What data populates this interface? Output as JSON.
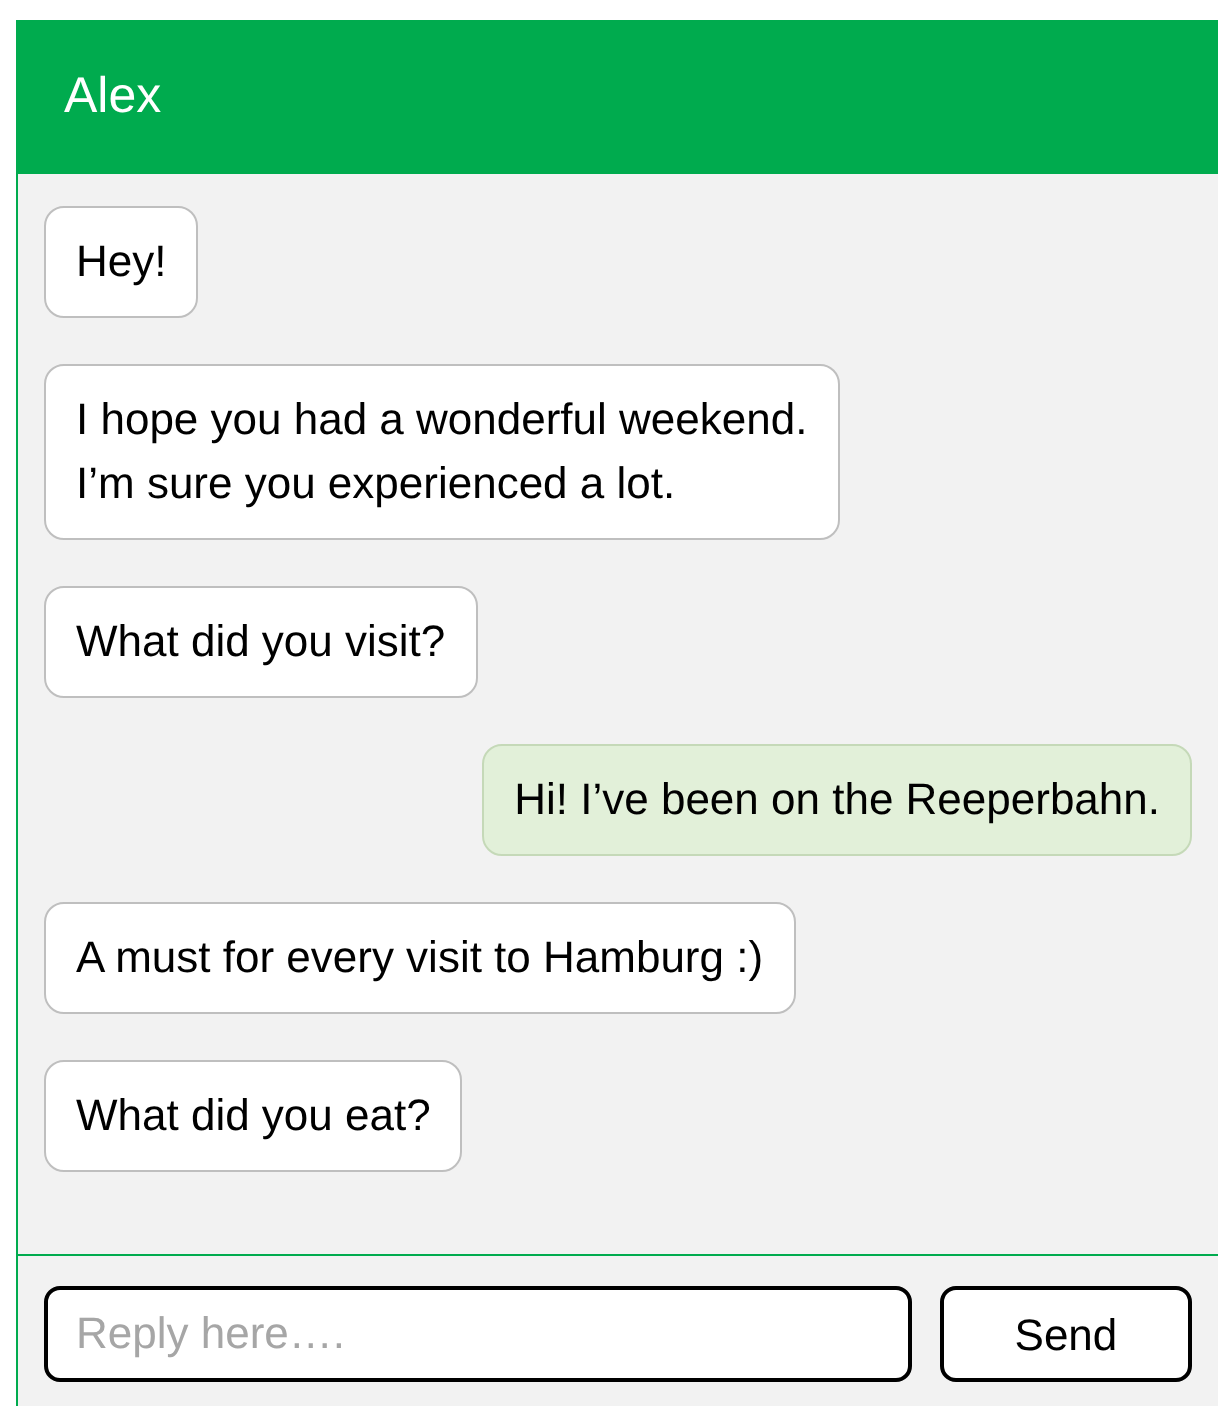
{
  "header": {
    "title": "Alex"
  },
  "messages": [
    {
      "kind": "received",
      "text": "Hey!"
    },
    {
      "kind": "received",
      "text": "I hope you had a wonderful weekend.\nI’m sure you experienced a lot."
    },
    {
      "kind": "received",
      "text": "What did you visit?"
    },
    {
      "kind": "sent",
      "text": "Hi! I’ve been on the Reeperbahn."
    },
    {
      "kind": "received",
      "text": "A must for every visit to Hamburg :)"
    },
    {
      "kind": "received",
      "text": "What did you eat?"
    }
  ],
  "composer": {
    "placeholder": "Reply here….",
    "button": "Send"
  }
}
